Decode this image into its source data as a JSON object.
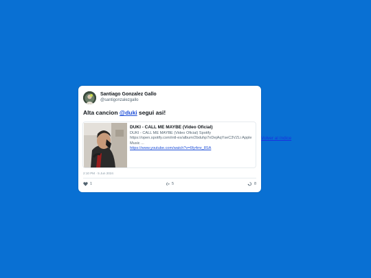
{
  "colors": {
    "background": "#0970d3",
    "card": "#ffffff",
    "link": "#1d4ed8",
    "text": "#0f1419",
    "muted": "#536471"
  },
  "tweet": {
    "author": {
      "display_name": "Santiago Gonzalez Gallo",
      "handle": "@santigonzalezgallo",
      "avatar_icon": "avatar"
    },
    "text_before": "Alta cancion ",
    "mention": "@duki",
    "text_after": " segui asi!",
    "embed": {
      "title": "DUKI - CALL ME MAYBE (Video Oficial)",
      "description": "DUKI - CALL ME MAYBE (Video Oficial) Spotify https://open.spotify.com/intl-es/album/2bduhp7nDejAqYseC3VZLi Apple Music ...",
      "url": "https://www.youtube.com/watch?v=6fy4mr_8SA",
      "thumbnail_icon": "video-thumbnail"
    },
    "timestamp": "2:10 PM · 5 Jun 2024",
    "actions": {
      "like_icon": "heart-icon",
      "like_count": "1",
      "reply_icon": "reply-icon",
      "reply_count": "5",
      "retweet_icon": "retweet-icon",
      "retweet_count": "8"
    }
  },
  "back_link": {
    "label": "Volver al índice"
  }
}
